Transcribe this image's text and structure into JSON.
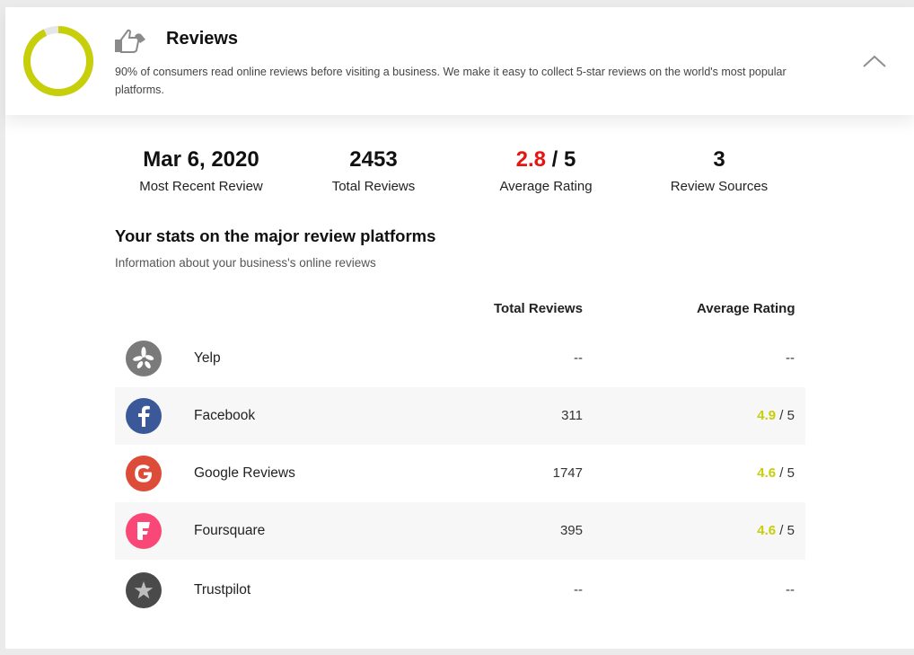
{
  "header": {
    "title": "Reviews",
    "description": "90% of consumers read online reviews before visiting a business. We make it easy to collect 5-star reviews on the world's most popular platforms.",
    "score_ring_fraction": 0.93,
    "ring_color": "#c7ce0a"
  },
  "stats": {
    "recent": {
      "value": "Mar 6, 2020",
      "label": "Most Recent Review"
    },
    "total": {
      "value": "2453",
      "label": "Total Reviews"
    },
    "average": {
      "value": "2.8",
      "suffix": " / 5",
      "label": "Average Rating"
    },
    "sources": {
      "value": "3",
      "label": "Review Sources"
    }
  },
  "section": {
    "title": "Your stats on the major review platforms",
    "subtitle": "Information about your business's online reviews"
  },
  "table": {
    "col_total": "Total Reviews",
    "col_rating": "Average Rating",
    "rows": [
      {
        "name": "Yelp",
        "icon": "yelp-icon",
        "total": "--",
        "rating": "",
        "rating_suffix": "--"
      },
      {
        "name": "Facebook",
        "icon": "facebook-icon",
        "total": "311",
        "rating": "4.9",
        "rating_suffix": " / 5"
      },
      {
        "name": "Google Reviews",
        "icon": "google-icon",
        "total": "1747",
        "rating": "4.6",
        "rating_suffix": " / 5"
      },
      {
        "name": "Foursquare",
        "icon": "foursquare-icon",
        "total": "395",
        "rating": "4.6",
        "rating_suffix": " / 5"
      },
      {
        "name": "Trustpilot",
        "icon": "trustpilot-icon",
        "total": "--",
        "rating": "",
        "rating_suffix": "--"
      }
    ]
  },
  "colors": {
    "accent": "#c7ce0a",
    "average_red": "#e8140f",
    "yelp": "#7a7a7a",
    "facebook": "#3b5998",
    "google": "#dd4b39",
    "foursquare": "#f94877",
    "trustpilot": "#4a4a4a"
  }
}
